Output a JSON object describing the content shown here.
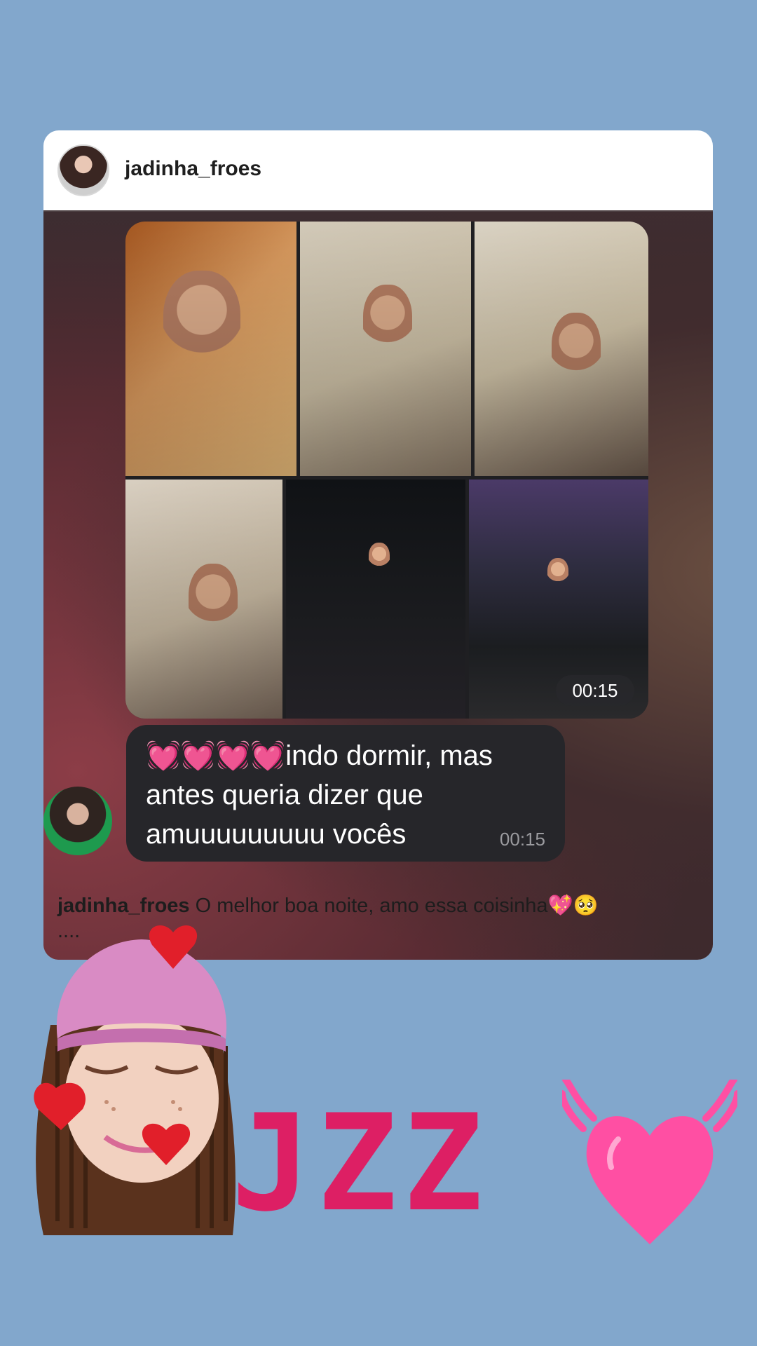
{
  "post": {
    "username": "jadinha_froes",
    "caption_user": "jadinha_froes",
    "caption_text": "O melhor boa noite, amo essa coisinha💖🥺",
    "caption_more": "...."
  },
  "media": {
    "video_duration": "00:15",
    "message": {
      "emoji": "💓💓💓💓",
      "text": "indo dormir, mas antes queria dizer que amuuuuuuuuu vocês",
      "time": "00:15"
    }
  },
  "sticker": {
    "text": "JZZ"
  },
  "colors": {
    "background": "#82a7cc",
    "sticker_text": "#dd1f64",
    "heart": "#ff4fa3"
  }
}
